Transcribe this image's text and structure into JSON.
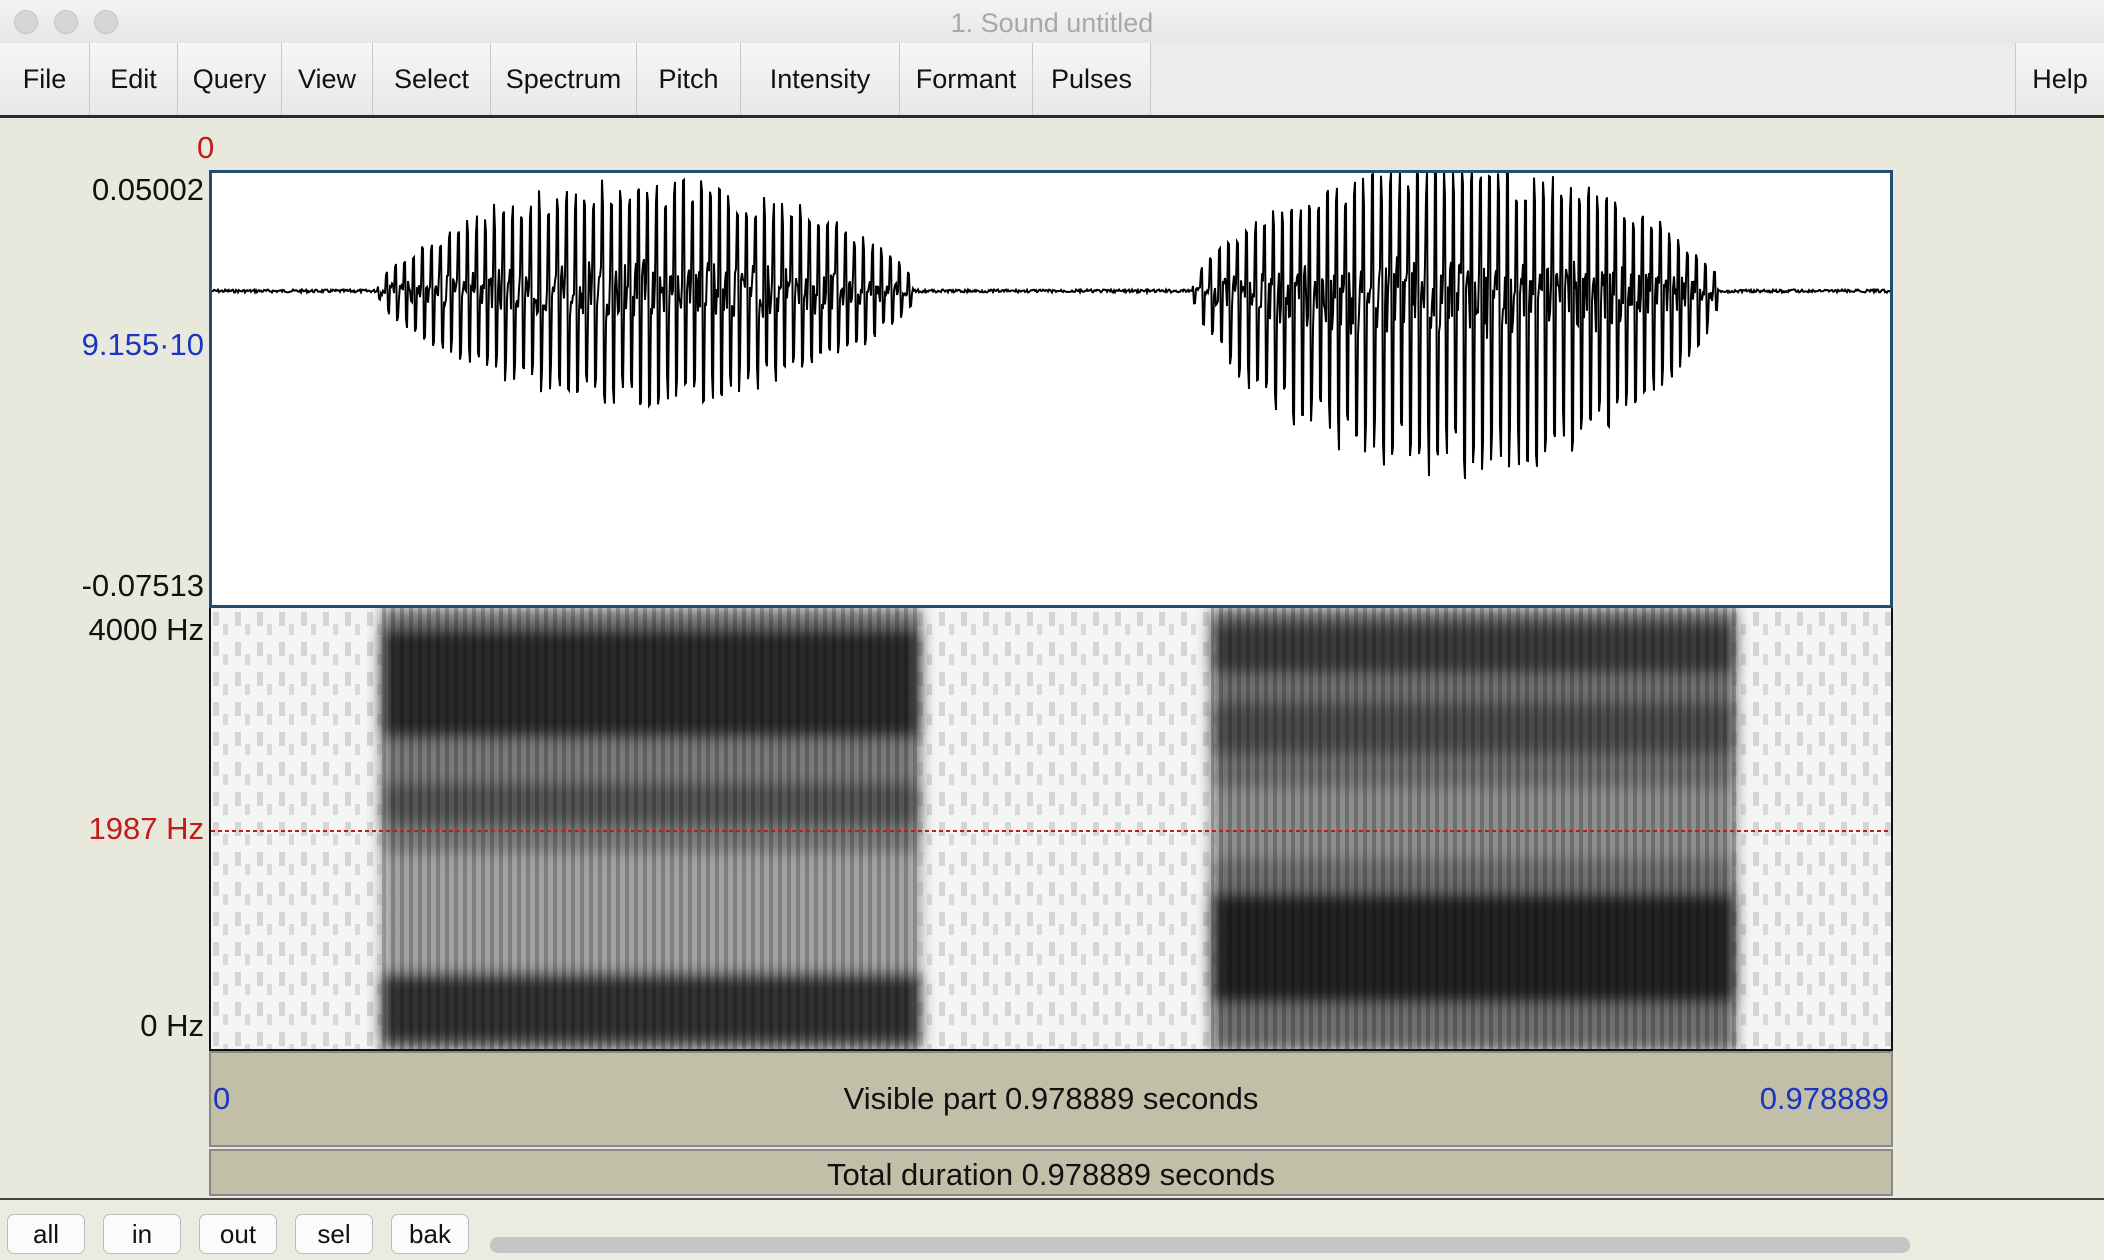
{
  "window": {
    "title": "1. Sound untitled"
  },
  "menu": {
    "items": [
      "File",
      "Edit",
      "Query",
      "View",
      "Select",
      "Spectrum",
      "Pitch",
      "Intensity",
      "Formant",
      "Pulses"
    ],
    "help": "Help"
  },
  "cursor": {
    "time_label": "0"
  },
  "waveform": {
    "y_max_label": "0.05002",
    "y_mid_label": "9.155·10",
    "y_min_label": "-0.07513"
  },
  "spectrogram": {
    "top_label": "4000 Hz",
    "cursor_label": "1987 Hz",
    "bottom_label": "0 Hz"
  },
  "time_bar": {
    "start": "0",
    "end": "0.978889",
    "visible_text": "Visible part 0.978889 seconds",
    "total_text": "Total duration 0.978889 seconds"
  },
  "bottom_buttons": {
    "all": "all",
    "in": "in",
    "out": "out",
    "sel": "sel",
    "bak": "bak"
  },
  "colors": {
    "blue_label": "#1b35c0",
    "red_label": "#c11b1b",
    "panel_bar": "#c1bfa7"
  }
}
